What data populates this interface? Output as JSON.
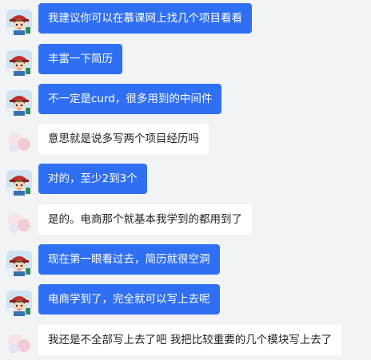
{
  "messages": [
    {
      "sender": "me",
      "text": "我建议你可以在慕课网上找几个项目看看"
    },
    {
      "sender": "me",
      "text": "丰富一下简历"
    },
    {
      "sender": "me",
      "text": "不一定是curd，很多用到的中间件"
    },
    {
      "sender": "other",
      "text": "意思就是说多写两个项目经历吗"
    },
    {
      "sender": "me",
      "text": "对的，至少2到3个"
    },
    {
      "sender": "other",
      "text": "是的。电商那个就基本我学到的都用到了"
    },
    {
      "sender": "me",
      "text": "现在第一眼看过去，简历就很空洞"
    },
    {
      "sender": "me",
      "text": "电商学到了，完全就可以写上去呢"
    },
    {
      "sender": "other",
      "text": "我还是不全部写上去了吧 我把比较重要的几个模块写上去了"
    }
  ],
  "colors": {
    "background": "#f2f3f5",
    "my_bubble": "#2f6ff3",
    "other_bubble": "#ffffff"
  }
}
